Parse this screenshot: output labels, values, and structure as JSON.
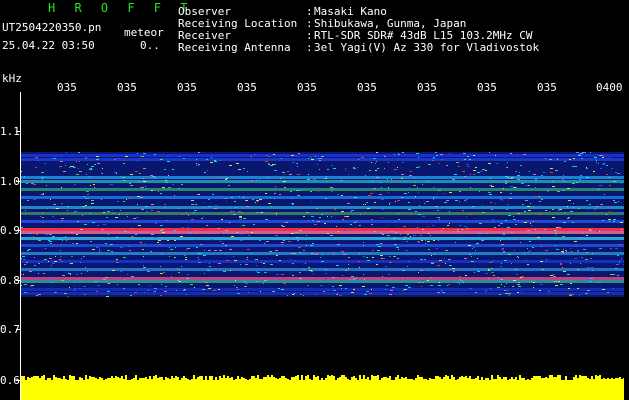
{
  "header": {
    "title": "H R O F F T",
    "filename": "UT2504220350.pn",
    "tag": "meteor",
    "datetime": "25.04.22 03:50",
    "count": "0.."
  },
  "info": [
    {
      "label": "Observer",
      "value": "Masaki Kano"
    },
    {
      "label": "Receiving Location",
      "value": "Shibukawa, Gunma, Japan"
    },
    {
      "label": "Receiver",
      "value": "RTL-SDR SDR# 43dB L15 103.2MHz CW"
    },
    {
      "label": "Receiving Antenna",
      "value": "3el Yagi(V) Az 330 for Vladivostok"
    }
  ],
  "axes": {
    "y_unit": "kHz",
    "y_labels": [
      "1.1",
      "1.0",
      "0.9",
      "0.8",
      "0.7",
      "0.6"
    ],
    "time_labels": [
      "035",
      "035",
      "035",
      "035",
      "035",
      "035",
      "035",
      "035",
      "035",
      "0400"
    ]
  },
  "colors": {
    "background": "#000000",
    "text": "#ffffff",
    "title": "#22e322",
    "axis_label": "#6fe8ff",
    "strong_band": "#ff3040",
    "signal_floor": "#ffff00"
  }
}
